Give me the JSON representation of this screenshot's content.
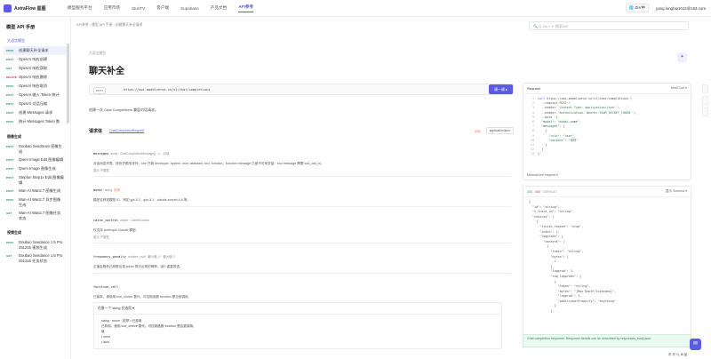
{
  "topbar": {
    "logo": "AstraFlow 星图",
    "nav": [
      "模型服务平台",
      "应用市场",
      "StoriTV",
      "客户端",
      "Supabase",
      "产品文档",
      "API参考"
    ],
    "active_nav": "API参考",
    "lang": "🌐 ZH/中",
    "user": "yang.longhai1012@163.com"
  },
  "search": {
    "placeholder": "🔍 Q  Ctrl + K 搜索API"
  },
  "sidebar": {
    "title": "模型 API 手册",
    "group1": "大语言模型",
    "items1": [
      {
        "m": "POST",
        "l": "创建聊天补全请求"
      },
      {
        "m": "POST",
        "l": "OpenAI 响应创建"
      },
      {
        "m": "GET",
        "l": "OpenAI 响应获取"
      },
      {
        "m": "DELETE",
        "l": "OpenAI 响应删除"
      },
      {
        "m": "POST",
        "l": "OpenAI 响应取消"
      },
      {
        "m": "POST",
        "l": "OpenAI 输入 Token 统计"
      },
      {
        "m": "POST",
        "l": "OpenAI 对话压缩"
      },
      {
        "m": "POST",
        "l": "创建 Messages 请求"
      },
      {
        "m": "POST",
        "l": "统计 Messages Token 数"
      }
    ],
    "group2": "图像生成",
    "items2": [
      {
        "m": "POST",
        "l": "Doubao Seedream 图像生成"
      },
      {
        "m": "POST",
        "l": "Qwen Image Edit 图像编辑"
      },
      {
        "m": "POST",
        "l": "Qwen Image 图像生成"
      },
      {
        "m": "POST",
        "l": "Stepfun Step1x Edit 图像编辑"
      },
      {
        "m": "POST",
        "l": "Wan-AI Wan2.7 图像生成"
      },
      {
        "m": "POST",
        "l": "Wan-AI Wan2.7 异步图像生成"
      },
      {
        "m": "GET",
        "l": "Wan-AI Wan2.7 图像任务状态"
      }
    ],
    "group3": "视频生成",
    "items3": [
      {
        "m": "POST",
        "l": "Doubao Seedance 1.5 Pro 251215 视频生成"
      },
      {
        "m": "GET",
        "l": "Doubao Seedance 1.5 Pro 251215 任务状态"
      }
    ]
  },
  "main": {
    "breadcrumb": "API参考 › 模型 API 手册 › 创建聊天补全请求",
    "subtitle": "大语言模型",
    "title": "聊天补全",
    "method": "POST",
    "url": "https://api.modelverse.cn/v1/chat/completions",
    "try_button": "调一调 ▸",
    "description": "创建一次 Chat Completions 兼容对话请求。",
    "body_label": "请求体",
    "body_link": "ChatCompletionRequest",
    "required": "必填",
    "content_type": "application/json",
    "fields": [
      {
        "name": "messages",
        "type": "array · ChatCompletionMessage[] · 1... 必填",
        "desc": "对话消息列表。按历史顺序排列，role 只能 developer, system, user, assistant, tool, function。function message 已被不可用变量：tool message 需要 tool_call_id。",
        "show": "显示 子属性"
      },
      {
        "name": "model",
        "type": "string",
        "req": "必填",
        "desc": "模型名称或模型 ID，例如 gpt-5.2、glm-5.1、claude-sonnet-4-6 等。"
      },
      {
        "name": "cache_control",
        "type": "object · CacheControl",
        "desc": "仅支持 Anthropic Claude 模型。",
        "show": "显示 子属性"
      },
      {
        "name": "frequency_penalty",
        "type": "number | null · 最小值 -2 · 最大值 2",
        "desc": "正值会降低已频繁出现 token 再次出现的概率，减少重复表述。"
      },
      {
        "name": "function_call",
        "type": "",
        "desc": "已废弃，请使用 tool_choice 替代。可控制函数 function 是否被调用。"
      }
    ],
    "select_box": {
      "header": "任意一个 string 仍选项 ▾",
      "line1": "string · enum · 枚举  • 已弃用",
      "line2": "已弃用。使用 tool_choice 替代。可控制函数 function 是否被调用。",
      "line3": "值",
      "opts": [
        "• none",
        "• auto"
      ]
    }
  },
  "request_panel": {
    "title": "Request",
    "lang_select": "Shell Curl ▾",
    "footer": "Minimal text request ▾"
  },
  "response_panel": {
    "codes": [
      "200",
      "400",
      "DEFAULT"
    ],
    "schema": "显示 Schema ▾"
  },
  "note": "Chat completion response. Response details can be described by responses_body.json.",
  "bottom_bar": "中 半 🔍 ⚙ 品"
}
